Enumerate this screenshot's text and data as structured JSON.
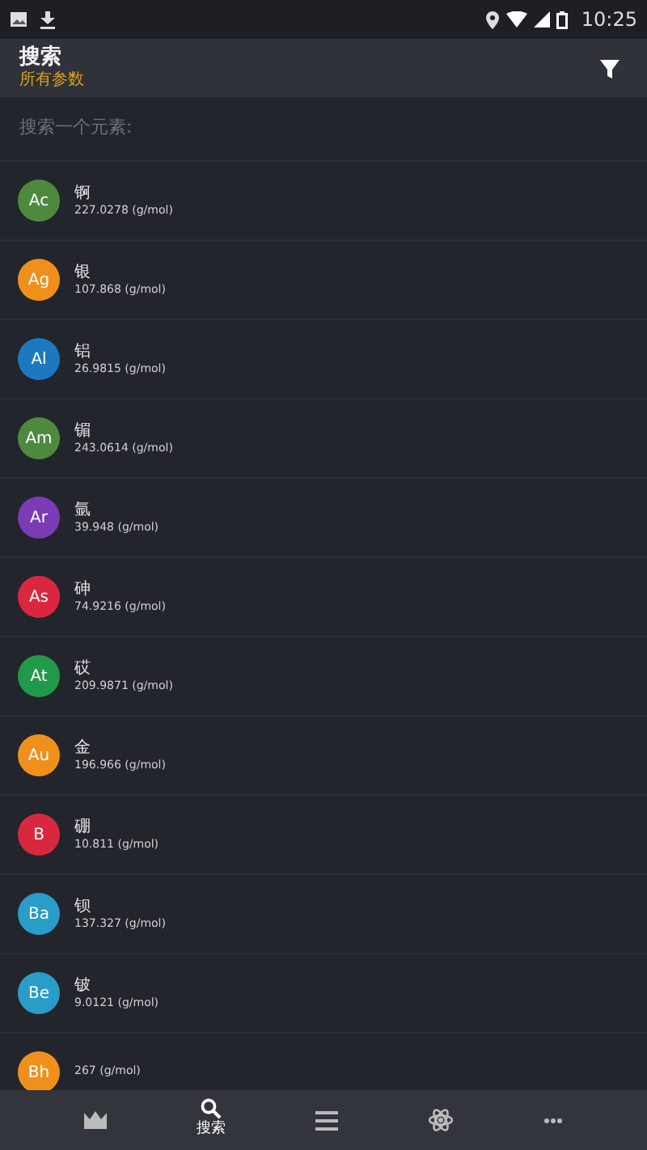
{
  "status_bar": {
    "time": "10:25"
  },
  "app_bar": {
    "title": "搜索",
    "subtitle": "所有参数"
  },
  "search": {
    "placeholder": "搜索一个元素:"
  },
  "elements": [
    {
      "symbol": "Ac",
      "name": "锕",
      "weight": "227.0278 (g/mol)",
      "color": "#4e8a3e"
    },
    {
      "symbol": "Ag",
      "name": "银",
      "weight": "107.868 (g/mol)",
      "color": "#f0901c"
    },
    {
      "symbol": "Al",
      "name": "铝",
      "weight": "26.9815 (g/mol)",
      "color": "#1d78c0"
    },
    {
      "symbol": "Am",
      "name": "镅",
      "weight": "243.0614 (g/mol)",
      "color": "#4e8a3e"
    },
    {
      "symbol": "Ar",
      "name": "氩",
      "weight": "39.948 (g/mol)",
      "color": "#7b3bb5"
    },
    {
      "symbol": "As",
      "name": "砷",
      "weight": "74.9216 (g/mol)",
      "color": "#d9273f"
    },
    {
      "symbol": "At",
      "name": "砹",
      "weight": "209.9871 (g/mol)",
      "color": "#21994a"
    },
    {
      "symbol": "Au",
      "name": "金",
      "weight": "196.966 (g/mol)",
      "color": "#f0901c"
    },
    {
      "symbol": "B",
      "name": "硼",
      "weight": "10.811 (g/mol)",
      "color": "#d9273f"
    },
    {
      "symbol": "Ba",
      "name": "钡",
      "weight": "137.327 (g/mol)",
      "color": "#2a9cc8"
    },
    {
      "symbol": "Be",
      "name": "铍",
      "weight": "9.0121 (g/mol)",
      "color": "#2a9cc8"
    },
    {
      "symbol": "Bh",
      "weight": "267 (g/mol)",
      "color": "#f0901c"
    }
  ],
  "bottom_nav": [
    {
      "kind": "crown",
      "selected": false
    },
    {
      "kind": "search",
      "label": "搜索",
      "selected": true
    },
    {
      "kind": "list",
      "selected": false
    },
    {
      "kind": "atom",
      "selected": false
    },
    {
      "kind": "more",
      "selected": false
    }
  ]
}
